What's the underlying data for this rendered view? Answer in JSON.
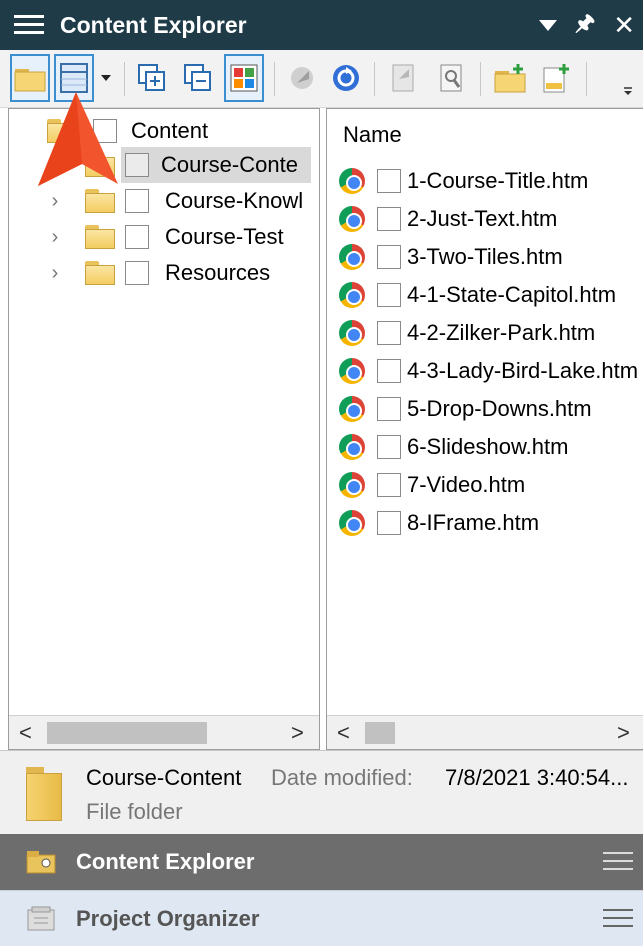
{
  "window": {
    "title": "Content Explorer"
  },
  "titlebar_icons": [
    "menu-icon",
    "dropdown-triangle-icon",
    "pin-icon",
    "close-icon"
  ],
  "toolbar": {
    "buttons": [
      {
        "name": "open-folder-icon",
        "selected": true
      },
      {
        "name": "table-view-icon",
        "selected": true
      },
      {
        "name": "dropdown-arrow-icon",
        "selected": false
      },
      {
        "name": "expand-all-icon",
        "selected": false
      },
      {
        "name": "collapse-all-icon",
        "selected": false
      },
      {
        "name": "show-files-icon",
        "selected": true
      },
      {
        "name": "binding-icon",
        "selected": false
      },
      {
        "name": "sync-icon",
        "selected": false
      },
      {
        "name": "properties-icon",
        "selected": false
      },
      {
        "name": "find-icon",
        "selected": false
      },
      {
        "name": "new-folder-icon",
        "selected": false
      },
      {
        "name": "add-file-icon",
        "selected": false
      }
    ]
  },
  "tree": {
    "root": "Content",
    "items": [
      {
        "label": "Course-Conte",
        "selected": true,
        "expander": false
      },
      {
        "label": "Course-Knowl",
        "selected": false,
        "expander": true
      },
      {
        "label": "Course-Test",
        "selected": false,
        "expander": true
      },
      {
        "label": "Resources",
        "selected": false,
        "expander": true
      }
    ]
  },
  "files": {
    "header": "Name",
    "items": [
      "1-Course-Title.htm",
      "2-Just-Text.htm",
      "3-Two-Tiles.htm",
      "4-1-State-Capitol.htm",
      "4-2-Zilker-Park.htm",
      "4-3-Lady-Bird-Lake.htm",
      "5-Drop-Downs.htm",
      "6-Slideshow.htm",
      "7-Video.htm",
      "8-IFrame.htm"
    ]
  },
  "scrollbars": {
    "left_arrow": "<",
    "right_arrow": ">"
  },
  "info": {
    "name": "Course-Content",
    "date_label": "Date modified:",
    "date_value": "7/8/2021 3:40:54...",
    "kind": "File folder"
  },
  "accordion": {
    "active_label": "Content Explorer",
    "inactive_label": "Project Organizer"
  },
  "colors": {
    "titlebar_bg": "#1f3b48",
    "accent_blue": "#3b8fd0",
    "arrow_orange": "#f2542d",
    "accordion_active": "#6d6d6d",
    "accordion_inactive": "#dfe8f2"
  }
}
